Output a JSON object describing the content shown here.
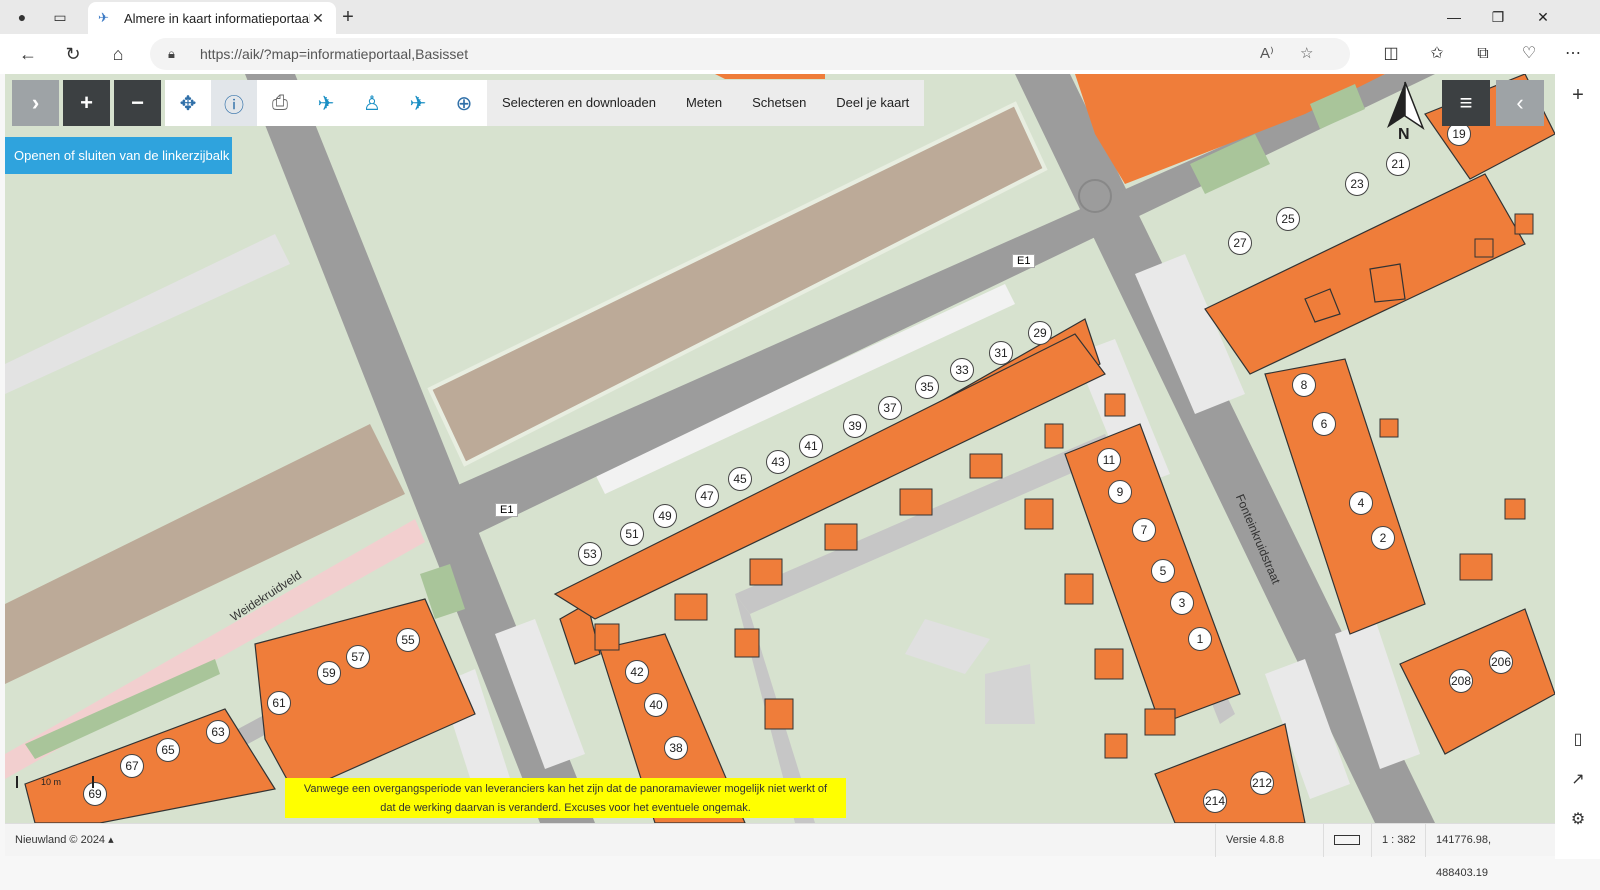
{
  "browser": {
    "tab_title": "Almere in kaart informatieportaal",
    "tab_close": "✕",
    "new_tab": "+",
    "url": "https://aik/?map=informatieportaal,Basisset",
    "window": {
      "minimize": "—",
      "restore": "❐",
      "close": "✕"
    }
  },
  "toolbar": {
    "toggle_sidebar": "›",
    "zoom_in": "+",
    "zoom_out": "−",
    "menu_items": [
      "Selecteren en downloaden",
      "Meten",
      "Schetsen",
      "Deel je kaart"
    ],
    "tooltip": "Openen of sluiten van de linkerzijbalk",
    "right_menu": "≡",
    "right_toggle": "‹",
    "north_label": "N"
  },
  "map": {
    "street_labels": [
      "Weidekruidveld",
      "Fonteinkruidstraat"
    ],
    "road_labels": [
      "E1",
      "E1"
    ],
    "house_numbers": [
      "19",
      "21",
      "23",
      "25",
      "27",
      "29",
      "31",
      "33",
      "35",
      "37",
      "39",
      "41",
      "43",
      "45",
      "47",
      "49",
      "51",
      "53",
      "55",
      "57",
      "59",
      "61",
      "63",
      "65",
      "67",
      "69",
      "1",
      "3",
      "5",
      "7",
      "9",
      "11",
      "2",
      "4",
      "6",
      "8",
      "38",
      "40",
      "42",
      "206",
      "208",
      "212",
      "214"
    ],
    "scale_label": "10 m"
  },
  "notice": {
    "line1": "Vanwege een overgangsperiode van leveranciers kan het zijn dat de panoramaviewer mogelijk niet werkt of",
    "line2": "dat de werking daarvan is veranderd. Excuses voor het eventuele ongemak."
  },
  "status": {
    "copyright": "Nieuwland © 2024",
    "version": "Versie 4.8.8",
    "scale": "1 : 382",
    "coordinates": "141776.98, 488403.19"
  },
  "colors": {
    "building": "#ef7d3a",
    "road": "#9c9c9c",
    "grass": "#d7e2cf",
    "accent": "#2fa3dd",
    "notice": "#ffff00"
  }
}
